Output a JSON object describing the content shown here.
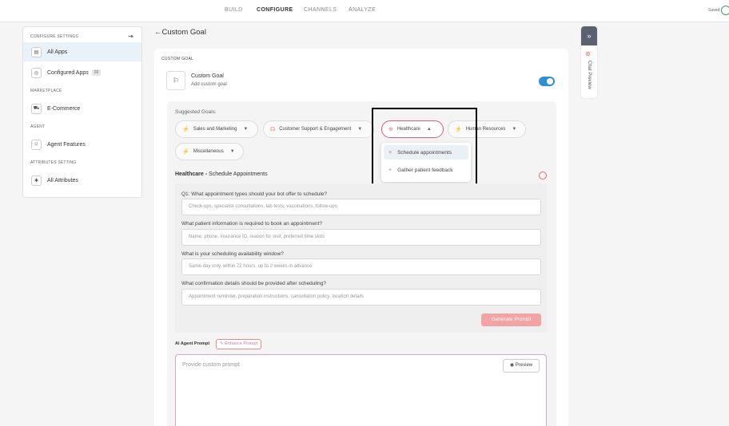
{
  "nav": {
    "tabs": [
      "BUILD",
      "CONFIGURE",
      "CHANNELS",
      "ANALYZE"
    ],
    "active": "CONFIGURE",
    "saved": "Saved"
  },
  "sidebar": {
    "section_configure": "CONFIGURE SETTINGS",
    "items_apps": [
      {
        "label": "All Apps"
      },
      {
        "label": "Configured Apps",
        "badge": "02"
      }
    ],
    "section_marketplace": "MARKETPLACE",
    "ecommerce": "E-Commerce",
    "section_agent": "AGENT",
    "agent_features": "Agent Features",
    "section_attributes": "ATTRIBUTES SETTING",
    "all_attributes": "All Attributes"
  },
  "page": {
    "back": "←",
    "title": "Custom Goal",
    "section_label": "CUSTOM GOAL"
  },
  "goal": {
    "title": "Custom Goal",
    "subtitle": "Add custom goal",
    "enabled": true
  },
  "suggested": {
    "label": "Suggested Goals:",
    "chips": [
      "Sales and Marketing",
      "Customer Support & Engagement",
      "Healthcare",
      "Human Resources",
      "Miscellaneous"
    ],
    "active": "Healthcare",
    "dropdown": [
      "Schedule appointments",
      "Gather patient feedback"
    ]
  },
  "selected": {
    "category": "Healthcare - ",
    "goal": "Schedule Appointments"
  },
  "questions": [
    {
      "label": "Q1: What appointment types should your bot offer to schedule?",
      "placeholder": "Check-ups, specialist consultations, lab tests, vaccinations, follow-ups"
    },
    {
      "label": "What patient information is required to book an appointment?",
      "placeholder": "Name, phone, insurance ID, reason for visit, preferred time slots"
    },
    {
      "label": "What is your scheduling availability window?",
      "placeholder": "Same-day only, within 72 hours, up to 2 weeks in advance"
    },
    {
      "label": "What confirmation details should be provided after scheduling?",
      "placeholder": "Appointment reminder, preparation instructions, cancellation policy, location details"
    }
  ],
  "generate_label": "Generate Prompt",
  "prompt": {
    "label": "AI Agent Prompt",
    "enhance": "Enhance Prompt",
    "placeholder": "Provide custom prompt",
    "preview": "Preview"
  },
  "chat_preview": {
    "label": "Chat Preview"
  }
}
